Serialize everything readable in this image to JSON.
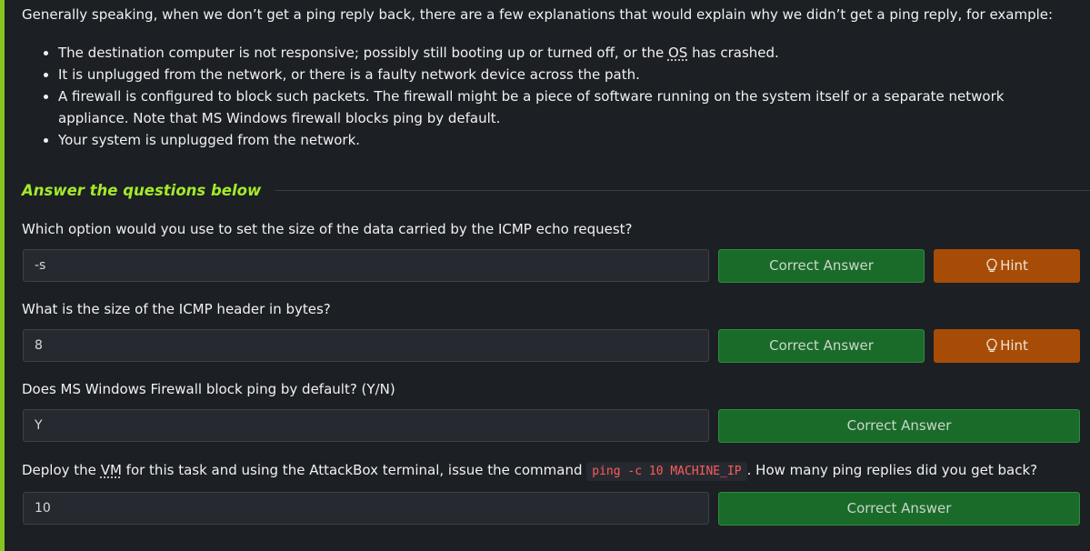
{
  "intro": "Generally speaking, when we don’t get a ping reply back, there are a few explanations that would explain why we didn’t get a ping reply, for example:",
  "bullets": [
    {
      "before": "The destination computer is not responsive; possibly still booting up or turned off, or the ",
      "abbr": "OS",
      "after": " has crashed."
    },
    {
      "text": "It is unplugged from the network, or there is a faulty network device across the path."
    },
    {
      "text": "A firewall is configured to block such packets. The firewall might be a piece of software running on the system itself or a separate network appliance. Note that MS Windows firewall blocks ping by default."
    },
    {
      "text": "Your system is unplugged from the network."
    }
  ],
  "answer_section_title": "Answer the questions below",
  "questions": [
    {
      "text": "Which option would you use to set the size of the data carried by the ICMP echo request?",
      "answer": "-s",
      "button": "Correct Answer",
      "hint": "Hint"
    },
    {
      "text": "What is the size of the ICMP header in bytes?",
      "answer": "8",
      "button": "Correct Answer",
      "hint": "Hint"
    },
    {
      "text": "Does MS Windows Firewall block ping by default? (Y/N)",
      "answer": "Y",
      "button": "Correct Answer"
    },
    {
      "text_before": "Deploy the ",
      "text_abbr": "VM",
      "text_middle": " for this task and using the AttackBox terminal, issue the command ",
      "code": "ping -c 10 MACHINE_IP",
      "text_after": ". How many ping replies did you get back?",
      "answer": "10",
      "button": "Correct Answer"
    }
  ],
  "colors": {
    "accent": "#88c41f",
    "correct_button": "#1a6b2a",
    "hint_button": "#a74c06",
    "code_text": "#ff5b5b"
  },
  "icons": {
    "hint": "lightbulb-icon"
  }
}
